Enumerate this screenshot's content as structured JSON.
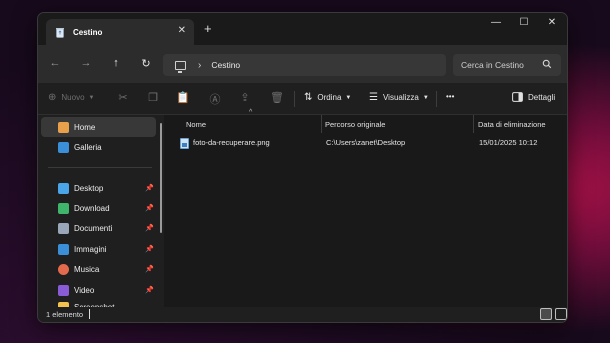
{
  "window": {
    "tab_title": "Cestino",
    "tab_close": "✕",
    "new_tab": "+",
    "minimize": "—",
    "maximize": "☐",
    "close": "✕"
  },
  "nav": {
    "back": "←",
    "forward": "→",
    "up": "↑",
    "refresh": "↻",
    "path_separator": "›",
    "breadcrumb": "Cestino"
  },
  "search": {
    "placeholder": "Cerca in Cestino"
  },
  "toolbar": {
    "new_label": "Nuovo",
    "sort_label": "Ordina",
    "view_label": "Visualizza",
    "more_label": "•••",
    "details_label": "Dettagli"
  },
  "sidebar": {
    "items": [
      {
        "label": "Home",
        "icon": "home-icon",
        "color": "#e8a14a",
        "selected": true
      },
      {
        "label": "Galleria",
        "icon": "gallery-icon",
        "color": "#3b8fd9"
      },
      {
        "label": "Desktop",
        "icon": "desktop-icon",
        "color": "#4aa6e8",
        "pinned": true
      },
      {
        "label": "Download",
        "icon": "download-icon",
        "color": "#3fb56b",
        "pinned": true
      },
      {
        "label": "Documenti",
        "icon": "documents-icon",
        "color": "#9aa7b8",
        "pinned": true
      },
      {
        "label": "Immagini",
        "icon": "pictures-icon",
        "color": "#3b8fd9",
        "pinned": true
      },
      {
        "label": "Musica",
        "icon": "music-icon",
        "color": "#e46a4e",
        "pinned": true
      },
      {
        "label": "Video",
        "icon": "video-icon",
        "color": "#8a5bd6",
        "pinned": true
      },
      {
        "label": "Screenshot",
        "icon": "folder-icon",
        "color": "#f2c14e"
      }
    ],
    "pin_glyph": "📌"
  },
  "columns": {
    "name": "Nome",
    "original_path": "Percorso originale",
    "deleted_date": "Data di eliminazione",
    "sort_indicator": "^"
  },
  "files": [
    {
      "name": "foto-da-recuperare.png",
      "original_path": "C:\\Users\\zanet\\Desktop",
      "deleted_date": "15/01/2025 10:12"
    }
  ],
  "status": {
    "count_text": "1 elemento"
  },
  "colors": {
    "window_bg": "#1f1f1f",
    "content_bg": "#191919",
    "selected_bg": "#383838",
    "wallpaper_accent": "#b0124a"
  }
}
